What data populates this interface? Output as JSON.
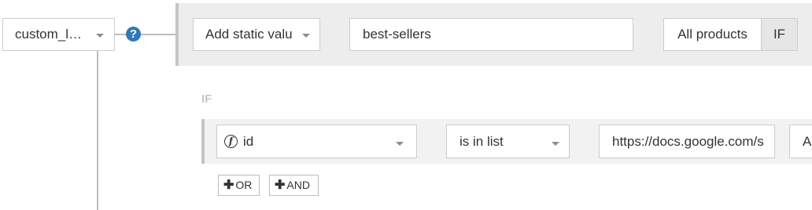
{
  "attribute": {
    "label": "custom_l…"
  },
  "help": {
    "glyph": "?",
    "icon": "question-circle-icon",
    "color": "#2e79b9"
  },
  "rule": {
    "value_type": "Add static valu",
    "static_value": "best-sellers",
    "scope_all_label": "All products",
    "scope_if_label": "IF"
  },
  "conditions": {
    "section_label": "IF",
    "row": {
      "field_icon": "function-icon",
      "field_icon_glyph": "f",
      "field": "id",
      "operator": "is in list",
      "value": "https://docs.google.com/s",
      "next_control_text": "A"
    },
    "add_or_label": "OR",
    "add_and_label": "AND",
    "plus_glyph": "✚"
  }
}
